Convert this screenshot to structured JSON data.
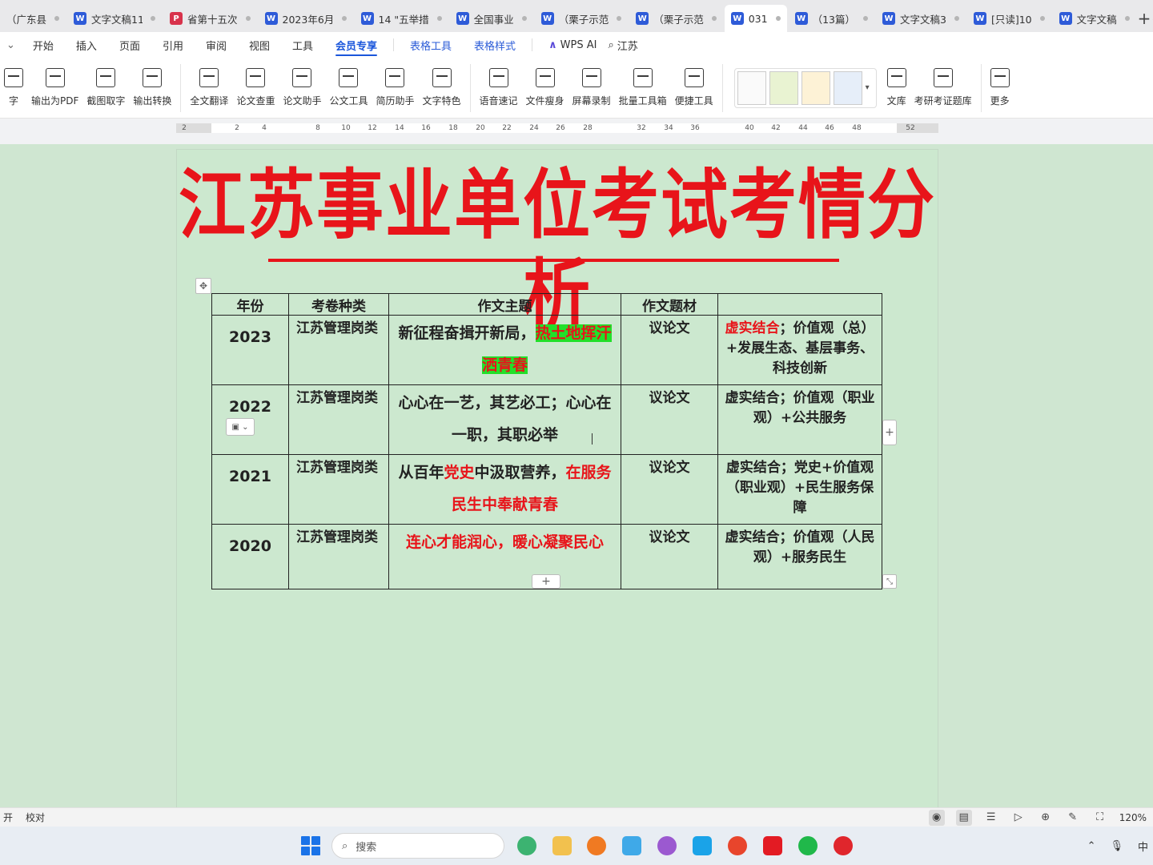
{
  "tabs": [
    {
      "title": "（广东县",
      "icon": "",
      "color": "#e9e9eb",
      "active": false
    },
    {
      "title": "文字文稿11",
      "icon": "W",
      "color": "#2e5bd8",
      "active": false
    },
    {
      "title": "省第十五次",
      "icon": "P",
      "color": "#d8324b",
      "active": false
    },
    {
      "title": "2023年6月",
      "icon": "W",
      "color": "#2e5bd8",
      "active": false
    },
    {
      "title": "14 \"五举措",
      "icon": "W",
      "color": "#2e5bd8",
      "active": false
    },
    {
      "title": "全国事业",
      "icon": "W",
      "color": "#2e5bd8",
      "active": false
    },
    {
      "title": "（栗子示范",
      "icon": "W",
      "color": "#2e5bd8",
      "active": false
    },
    {
      "title": "（栗子示范",
      "icon": "W",
      "color": "#2e5bd8",
      "active": false
    },
    {
      "title": "031",
      "icon": "W",
      "color": "#2e5bd8",
      "active": true
    },
    {
      "title": "（13篇）",
      "icon": "W",
      "color": "#2e5bd8",
      "active": false
    },
    {
      "title": "文字文稿3",
      "icon": "W",
      "color": "#2e5bd8",
      "active": false
    },
    {
      "title": "[只读]10",
      "icon": "W",
      "color": "#2e5bd8",
      "active": false
    },
    {
      "title": "文字文稿",
      "icon": "W",
      "color": "#2e5bd8",
      "active": false
    }
  ],
  "menu": {
    "items": [
      "开始",
      "插入",
      "页面",
      "引用",
      "审阅",
      "视图",
      "工具",
      "会员专享"
    ],
    "active": "会员专享",
    "context": [
      "表格工具",
      "表格样式"
    ],
    "ai": "WPS AI",
    "search": "江苏"
  },
  "ribbon": {
    "group1": [
      "字",
      "输出为PDF",
      "截图取字",
      "输出转换"
    ],
    "group2": [
      "全文翻译",
      "论文查重",
      "论文助手",
      "公文工具",
      "简历助手",
      "文字特色"
    ],
    "group3": [
      "语音速记",
      "文件瘦身",
      "屏幕录制",
      "批量工具箱",
      "便捷工具"
    ],
    "group4": [
      "文库",
      "考研考证题库"
    ],
    "group5": [
      "更多"
    ]
  },
  "ruler": {
    "ticks": [
      "2",
      "2",
      "4",
      "8",
      "10",
      "12",
      "14",
      "16",
      "18",
      "20",
      "22",
      "24",
      "26",
      "28",
      "32",
      "34",
      "36",
      "40",
      "42",
      "44",
      "46",
      "48",
      "52"
    ]
  },
  "document": {
    "title": "江苏事业单位考试考情分析",
    "table": {
      "headers": [
        "年份",
        "考卷种类",
        "作文主题",
        "作文题材",
        ""
      ],
      "rows": [
        {
          "year": "2023",
          "kind": "江苏管理岗类",
          "topic_plain": "新征程奋揖开新局，",
          "topic_highlight": "热土地挥汗洒青春",
          "genre": "议论文",
          "material_red": "虚实结合",
          "material_rest": "；价值观（总）+发展生态、基层事务、科技创新"
        },
        {
          "year": "2022",
          "kind": "江苏管理岗类",
          "topic": "心心在一艺，其艺必工；心心在一职，其职必举",
          "genre": "议论文",
          "material": "虚实结合；价值观（职业观）+公共服务"
        },
        {
          "year": "2021",
          "kind": "江苏管理岗类",
          "topic_a": "从百年",
          "topic_b_red": "党史",
          "topic_c": "中汲取营养，",
          "topic_d_red": "在服务民生中奉献青春",
          "genre": "议论文",
          "material": "虚实结合；党史+价值观（职业观）+民生服务保障"
        },
        {
          "year": "2020",
          "kind": "江苏管理岗类",
          "topic_red": "连心才能润心，暖心凝聚民心",
          "genre": "议论文",
          "material": "虚实结合；价值观（人民观）+服务民生"
        }
      ]
    }
  },
  "statusbar": {
    "left": [
      "开",
      "校对"
    ],
    "zoom": "120%"
  },
  "taskbar": {
    "search_placeholder": "搜索",
    "tray_ime": "中"
  },
  "colors": {
    "accent": "#1a56db",
    "title_red": "#e8141a",
    "highlight_green": "#22e02a",
    "canvas_bg": "#cfe6d1"
  }
}
